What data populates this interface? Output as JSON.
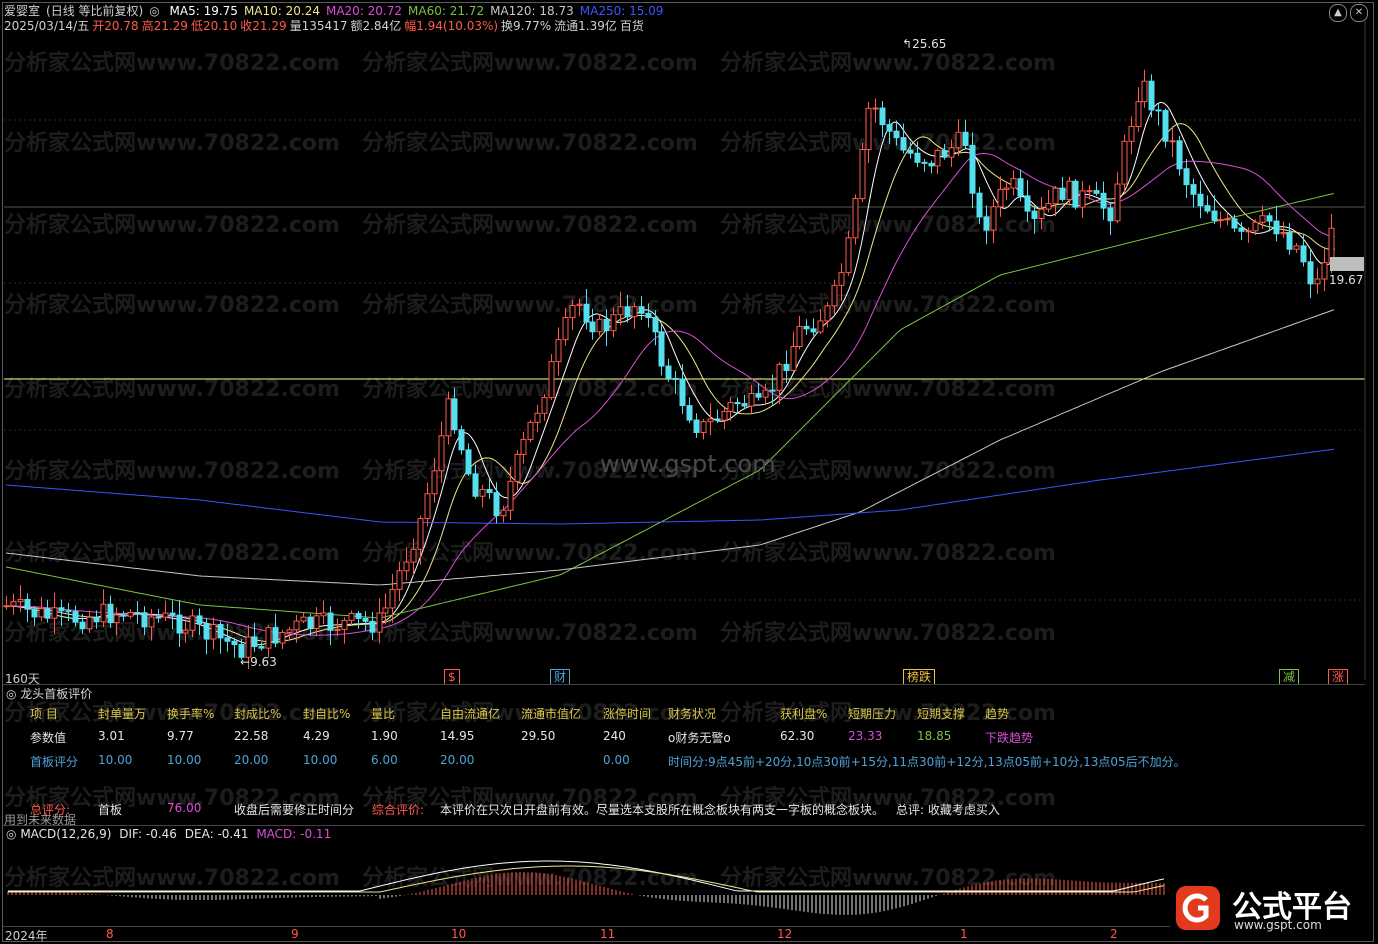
{
  "header": {
    "stock_name": "爱婴室",
    "mode": "(日线 等比前复权)",
    "ma": [
      {
        "label": "MA5: 19.75",
        "color": "#ffffff"
      },
      {
        "label": "MA10: 20.24",
        "color": "#f0e68c"
      },
      {
        "label": "MA20: 20.72",
        "color": "#d94fd8"
      },
      {
        "label": "MA60: 21.72",
        "color": "#7cc242"
      },
      {
        "label": "MA120: 18.73",
        "color": "#c8c8c8"
      },
      {
        "label": "MA250: 15.09",
        "color": "#3c55ff"
      }
    ],
    "line2": [
      {
        "text": "2025/03/14/五",
        "color": "#cfcfcf"
      },
      {
        "text": "开20.78",
        "color": "#ff5a4a"
      },
      {
        "text": "高21.29",
        "color": "#ff5a4a"
      },
      {
        "text": "低20.10",
        "color": "#ff5a4a"
      },
      {
        "text": "收21.29",
        "color": "#ff5a4a"
      },
      {
        "text": "量135417",
        "color": "#cfcfcf"
      },
      {
        "text": "额2.84亿",
        "color": "#cfcfcf"
      },
      {
        "text": "幅1.94(10.03%)",
        "color": "#ff5a4a"
      },
      {
        "text": "换9.77%",
        "color": "#cfcfcf"
      },
      {
        "text": "流通1.39亿",
        "color": "#cfcfcf"
      },
      {
        "text": "百货",
        "color": "#cfcfcf"
      }
    ]
  },
  "chart_data": {
    "type": "candlestick",
    "period_label": "160天",
    "high_marker": "25.65",
    "low_marker": "9.63",
    "last_price_tag": "19.67",
    "watermark_text": "www.gspt.com",
    "repeated_watermark": "分析家公式网www.70822.com",
    "event_badges": [
      {
        "text": "$",
        "color": "#ff5a4a"
      },
      {
        "text": "财",
        "color": "#4fa2d8"
      },
      {
        "text": "榜跌",
        "color": "#f0c040"
      },
      {
        "text": "减",
        "color": "#7cc242"
      },
      {
        "text": "涨",
        "color": "#ff5a4a"
      }
    ],
    "x_axis_labels": [
      "2024年",
      "8",
      "9",
      "10",
      "11",
      "12",
      "1",
      "2"
    ]
  },
  "panel": {
    "title": "龙头首板评价",
    "headers": [
      "项 目",
      "封单量万",
      "换手率%",
      "封成比%",
      "封自比%",
      "量比",
      "自由流通亿",
      "流通市值亿",
      "涨停时间",
      "财务状况",
      "获利盘%",
      "短期压力",
      "短期支撑",
      "趋势"
    ],
    "row1_label": "参数值",
    "row1": [
      "3.01",
      "9.77",
      "22.58",
      "4.29",
      "1.90",
      "14.95",
      "29.50",
      "240",
      "o财务无警o",
      "62.30",
      "23.33",
      "18.85",
      "下跌趋势"
    ],
    "row2_label": "首板评分",
    "row2": [
      "10.00",
      "10.00",
      "20.00",
      "10.00",
      "6.00",
      "20.00",
      "",
      "0.00"
    ],
    "time_note": "时间分:9点45前+20分,10点30前+15分,11点30前+12分,13点05前+10分,13点05后不加分。",
    "total_label": "总评分:",
    "total_kind": "首板",
    "total_value": "76.00",
    "note1": "收盘后需要修正时间分",
    "comp_label": "综合评价:",
    "comp_text": "本评价在只次日开盘前有效。尽量选本支股所在概念板块有两支一字板的概念板块。",
    "summary": "总评: 收藏考虑买入",
    "future_note": "用到未来数据"
  },
  "macd": {
    "label": "MACD(12,26,9)",
    "dif": "DIF: -0.46",
    "dea": "DEA: -0.41",
    "macd": "MACD: -0.11"
  },
  "logo": {
    "text": "公式平台",
    "url": "www.gspt.com"
  }
}
